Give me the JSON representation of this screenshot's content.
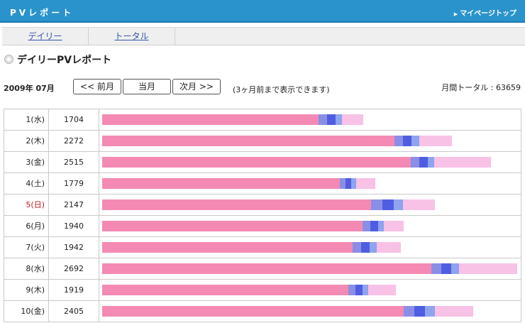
{
  "header": {
    "title": "PVレポート",
    "mypage_link": "マイページトップ"
  },
  "tabs": [
    {
      "label": "デイリー"
    },
    {
      "label": "トータル"
    }
  ],
  "section_title": "デイリーPVレポート",
  "controls": {
    "month": "2009年 07月",
    "prev_label": "<< 前月",
    "current_label": "当月",
    "next_label": "次月 >>",
    "note": "(3ヶ月前まで表示できます)",
    "total": "月間トータル : 63659"
  },
  "colors": {
    "header_bg": "#2a93cc",
    "bar_main": "#f48ab4",
    "bar_blue_dark": "#4f5ee0",
    "bar_blue_light": "#8a8ee6",
    "bar_tail": "#f8c1e6",
    "sunday_text": "#c01818"
  },
  "rows": [
    {
      "day": "1(水)",
      "count": "1704",
      "value": 1704,
      "main": 0.52,
      "blue": 0.056,
      "tail": 0.052
    },
    {
      "day": "2(木)",
      "count": "2272",
      "value": 2272,
      "main": 0.703,
      "blue": 0.06,
      "tail": 0.079
    },
    {
      "day": "3(金)",
      "count": "2515",
      "value": 2515,
      "main": 0.742,
      "blue": 0.056,
      "tail": 0.137
    },
    {
      "day": "4(土)",
      "count": "1779",
      "value": 1779,
      "main": 0.571,
      "blue": 0.04,
      "tail": 0.046
    },
    {
      "day": "5(日)",
      "count": "2147",
      "value": 2147,
      "main": 0.646,
      "blue": 0.077,
      "tail": 0.077,
      "sunday": true
    },
    {
      "day": "6(月)",
      "count": "1940",
      "value": 1940,
      "main": 0.627,
      "blue": 0.052,
      "tail": 0.048
    },
    {
      "day": "7(火)",
      "count": "1942",
      "value": 1942,
      "main": 0.602,
      "blue": 0.058,
      "tail": 0.058
    },
    {
      "day": "8(水)",
      "count": "2692",
      "value": 2692,
      "main": 0.792,
      "blue": 0.067,
      "tail": 0.14
    },
    {
      "day": "9(木)",
      "count": "1919",
      "value": 1919,
      "main": 0.592,
      "blue": 0.048,
      "tail": 0.067
    },
    {
      "day": "10(金)",
      "count": "2405",
      "value": 2405,
      "main": 0.725,
      "blue": 0.075,
      "tail": 0.092
    }
  ]
}
